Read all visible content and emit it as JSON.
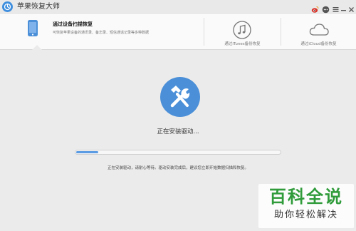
{
  "window": {
    "title": "苹果恢复大师",
    "icons": [
      "weibo-icon",
      "chat-icon",
      "menu-icon",
      "minimize-icon",
      "close-icon"
    ]
  },
  "tabs": [
    {
      "title": "通过设备扫描恢复",
      "desc": "可恢复苹果设备的通讯录、备忘录、短信通话记录等多种数据",
      "icon": "phone-icon",
      "active": true
    },
    {
      "label": "通过iTunes备份恢复",
      "icon": "music-icon",
      "active": false
    },
    {
      "label": "通过iCloud备份恢复",
      "icon": "cloud-icon",
      "active": false
    }
  ],
  "main": {
    "icon": "tools-icon",
    "status": "正在安装驱动...",
    "progress": 0.11,
    "hint": "正在安装驱动，请耐心等待。驱动安装完成后，建议您立即开始数据扫描和恢复。"
  },
  "watermark": {
    "title": "百科全说",
    "subtitle": "助你轻松解决"
  },
  "colors": {
    "accent": "#4a8fd8",
    "progress": "#5b9be3",
    "watermark_green": "#2f9b3a"
  }
}
